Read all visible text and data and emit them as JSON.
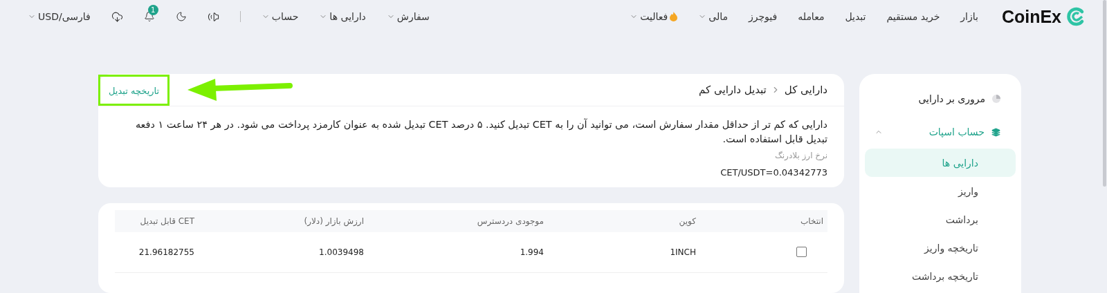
{
  "header": {
    "logo": "CoinEx",
    "nav": [
      {
        "label": "بازار",
        "dropdown": false,
        "hot": false
      },
      {
        "label": "خرید مستقیم",
        "dropdown": false,
        "hot": false
      },
      {
        "label": "تبدیل",
        "dropdown": false,
        "hot": false
      },
      {
        "label": "معامله",
        "dropdown": false,
        "hot": false
      },
      {
        "label": "فیوچرز",
        "dropdown": false,
        "hot": false
      },
      {
        "label": "مالی",
        "dropdown": true,
        "hot": false
      },
      {
        "label": "فعالیت",
        "dropdown": true,
        "hot": true
      }
    ],
    "user_menu": [
      {
        "label": "سفارش",
        "dropdown": true
      },
      {
        "label": "دارایی ها",
        "dropdown": true
      },
      {
        "label": "حساب",
        "dropdown": true
      }
    ],
    "notification_count": "1",
    "language": "فارسی/USD"
  },
  "sidebar": {
    "items": [
      {
        "label": "مروری بر دارایی",
        "kind": "link",
        "selected": false
      },
      {
        "label": "حساب اسپات",
        "kind": "group",
        "expanded": true,
        "selected": false,
        "children": [
          {
            "label": "دارایی ها",
            "selected": true
          },
          {
            "label": "واریز",
            "selected": false
          },
          {
            "label": "برداشت",
            "selected": false
          },
          {
            "label": "تاریخچه واریز",
            "selected": false
          },
          {
            "label": "تاریخچه برداشت",
            "selected": false
          }
        ]
      }
    ]
  },
  "main": {
    "breadcrumb": [
      "دارایی کل",
      "تبدیل دارایی کم"
    ],
    "history_link": {
      "label": "تاریخچه تبدیل",
      "highlighted": true
    },
    "description": "دارایی که کم تر از حداقل مقدار سفارش است، می توانید آن را به CET تبدیل کنید. ۵ درصد CET تبدیل شده به عنوان کارمزد پرداخت می شود. در هر ۲۴ ساعت ۱ دفعه تبدیل قابل استفاده است.",
    "rate_label": "نرخ ارز بلادرنگ",
    "rate_value": "CET/USDT=0.04342773"
  },
  "table": {
    "columns": [
      "انتخاب",
      "کوین",
      "موجودی دردسترس",
      "ارزش بازار (دلار)",
      "CET قابل تبدیل"
    ],
    "rows": [
      {
        "checked": false,
        "cells": [
          "",
          "1INCH",
          "1.994",
          "1.0039498",
          "21.96182755"
        ]
      }
    ]
  }
}
